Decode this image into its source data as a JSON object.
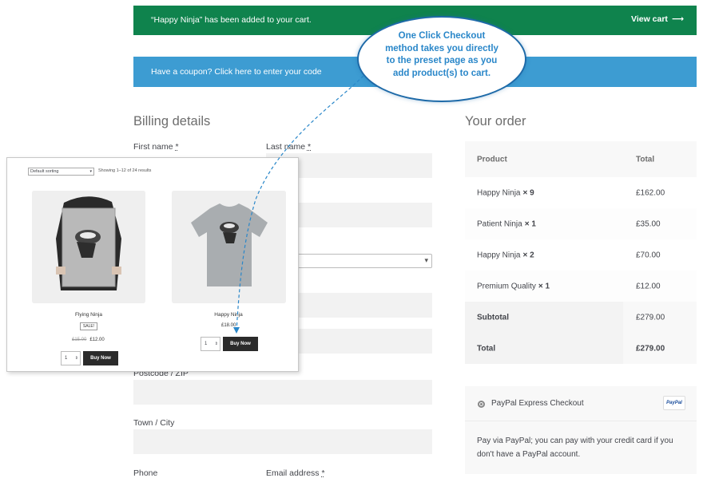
{
  "notices": {
    "added_message": "“Happy Ninja” has been added to your cart.",
    "view_cart": "View cart",
    "view_cart_arrow": "⟶",
    "coupon_message": "Have a coupon? Click here to enter your code"
  },
  "billing": {
    "heading": "Billing details",
    "first_name": "First name",
    "last_name": "Last name",
    "required_mark": "*",
    "postcode": "Postcode / ZIP",
    "town": "Town / City",
    "phone": "Phone",
    "email": "Email address"
  },
  "order": {
    "heading": "Your order",
    "col_product": "Product",
    "col_total": "Total",
    "items": [
      {
        "name": "Happy Ninja",
        "qty": "× 9",
        "total": "£162.00"
      },
      {
        "name": "Patient Ninja",
        "qty": "× 1",
        "total": "£35.00"
      },
      {
        "name": "Happy Ninja",
        "qty": "× 2",
        "total": "£70.00"
      },
      {
        "name": "Premium Quality",
        "qty": "× 1",
        "total": "£12.00"
      }
    ],
    "subtotal_label": "Subtotal",
    "subtotal_value": "£279.00",
    "total_label": "Total",
    "total_value": "£279.00"
  },
  "payment": {
    "method": "PayPal Express Checkout",
    "logo": "PayPal",
    "description": "Pay via PayPal; you can pay with your credit card if you don't have a PayPal account."
  },
  "shop_overlay": {
    "sort_value": "Default sorting",
    "showing": "Showing 1–12 of 24 results",
    "products": [
      {
        "name": "Flying Ninja",
        "badge": "SALE!",
        "old_price": "£15.00",
        "price": "£12.00",
        "qty": "1",
        "button": "Buy Now"
      },
      {
        "name": "Happy Ninja",
        "price": "£18.00",
        "qty": "1",
        "button": "Buy Now"
      }
    ]
  },
  "callout": {
    "line1": "One Click Checkout",
    "line2": "method takes you directly",
    "line3": "to the preset page as you",
    "line4": "add product(s) to cart."
  },
  "colors": {
    "success": "#0f834d",
    "info": "#3d9cd2",
    "callout_border": "#1e6aa8",
    "callout_text": "#2a87c9"
  }
}
